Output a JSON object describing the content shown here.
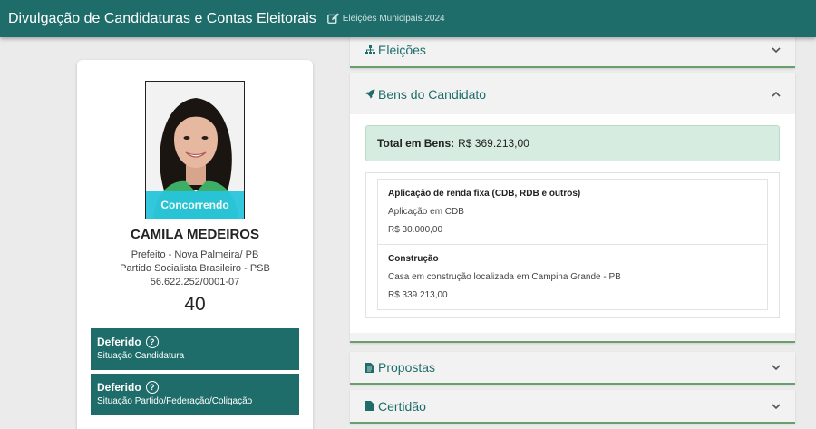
{
  "header": {
    "title": "Divulgação de Candidaturas e Contas Eleitorais",
    "election": "Eleições Municipais 2024"
  },
  "candidate": {
    "photo_badge": "Concorrendo",
    "name": "CAMILA MEDEIROS",
    "office": "Prefeito - Nova Palmeira/ PB",
    "party": "Partido Socialista Brasileiro - PSB",
    "cnpj": "56.622.252/0001-07",
    "number": "40",
    "status": [
      {
        "title": "Deferido",
        "subtitle": "Situação Candidatura"
      },
      {
        "title": "Deferido",
        "subtitle": "Situação Partido/Federação/Coligação"
      }
    ]
  },
  "sections": {
    "eleicoes": {
      "label": "Eleições",
      "icon": "sitemap-icon",
      "expanded": false
    },
    "bens": {
      "label": "Bens do Candidato",
      "icon": "rocket-icon",
      "expanded": true
    },
    "propostas": {
      "label": "Propostas",
      "icon": "file-icon",
      "expanded": false
    },
    "certidao": {
      "label": "Certidão",
      "icon": "file-icon",
      "expanded": false
    }
  },
  "bens": {
    "total_label": "Total em Bens:",
    "total_value": "R$ 369.213,00",
    "items": [
      {
        "title": "Aplicação de renda fixa (CDB, RDB e outros)",
        "description": "Aplicação em CDB",
        "value": "R$ 30.000,00"
      },
      {
        "title": "Construção",
        "description": "Casa em construção localizada em Campina Grande - PB",
        "value": "R$ 339.213,00"
      }
    ]
  },
  "colors": {
    "primary": "#1e6d6a",
    "badge": "#28c5dc",
    "total_bg": "#d6ece0",
    "accent_border": "#6a9e6e"
  }
}
